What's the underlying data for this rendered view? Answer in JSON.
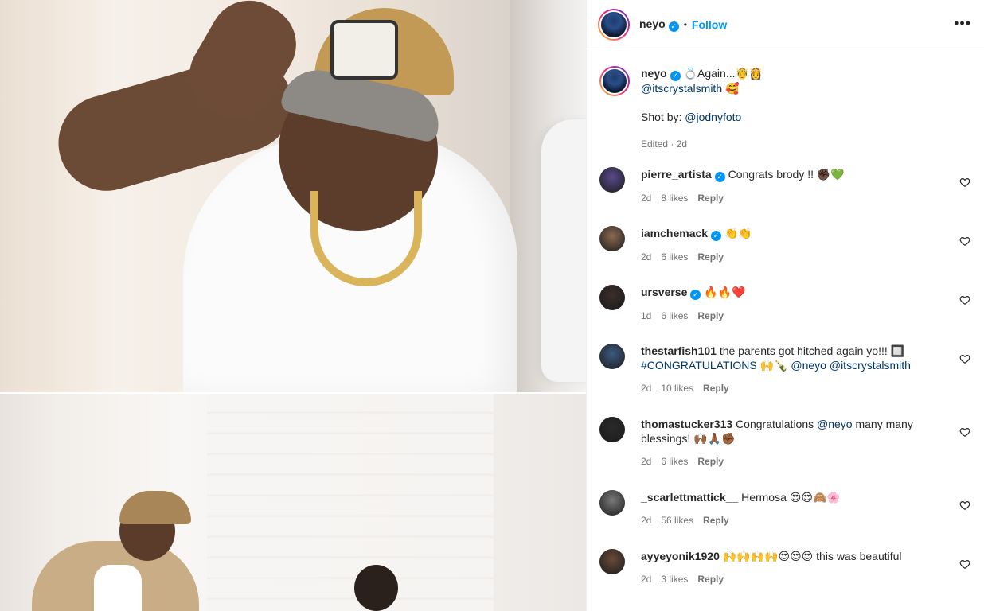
{
  "header": {
    "username": "neyo",
    "verified_badge": "✓",
    "separator": "•",
    "follow_label": "Follow",
    "more_icon": "•••"
  },
  "caption": {
    "username": "neyo",
    "text": "💍Again...🤴👸",
    "mention": "@itscrystalsmith",
    "mention_suffix": " 🥰",
    "shot_by_label": "Shot by: ",
    "shot_by_mention": "@jodnyfoto",
    "meta": "Edited · 2d"
  },
  "comments": [
    {
      "username": "pierre_artista",
      "verified": true,
      "parts": [
        {
          "t": "text",
          "v": "Congrats brody !! ✊🏿💚"
        }
      ],
      "time": "2d",
      "likes": "8 likes",
      "reply": "Reply",
      "avatar_color": "#5a4a8a"
    },
    {
      "username": "iamchemack",
      "verified": true,
      "parts": [
        {
          "t": "text",
          "v": "👏👏"
        }
      ],
      "time": "2d",
      "likes": "6 likes",
      "reply": "Reply",
      "avatar_color": "#8a6a52"
    },
    {
      "username": "ursverse",
      "verified": true,
      "parts": [
        {
          "t": "text",
          "v": "🔥🔥❤️"
        }
      ],
      "time": "1d",
      "likes": "6 likes",
      "reply": "Reply",
      "avatar_color": "#3a2e2a"
    },
    {
      "username": "thestarfish101",
      "verified": false,
      "parts": [
        {
          "t": "text",
          "v": "the parents got hitched again yo!!! 🔲"
        },
        {
          "t": "br"
        },
        {
          "t": "mention",
          "v": "#CONGRATULATIONS"
        },
        {
          "t": "text",
          "v": " 🙌🍾 "
        },
        {
          "t": "mention",
          "v": "@neyo"
        },
        {
          "t": "text",
          "v": " "
        },
        {
          "t": "mention",
          "v": "@itscrystalsmith"
        }
      ],
      "time": "2d",
      "likes": "10 likes",
      "reply": "Reply",
      "avatar_color": "#3c5a80"
    },
    {
      "username": "thomastucker313",
      "verified": false,
      "parts": [
        {
          "t": "text",
          "v": "Congratulations "
        },
        {
          "t": "mention",
          "v": "@neyo"
        },
        {
          "t": "text",
          "v": " many many"
        },
        {
          "t": "br"
        },
        {
          "t": "text",
          "v": "blessings! 🙌🏾🙏🏾✊🏾"
        }
      ],
      "time": "2d",
      "likes": "6 likes",
      "reply": "Reply",
      "avatar_color": "#2a2a2a"
    },
    {
      "username": "_scarlettmattick__",
      "verified": false,
      "parts": [
        {
          "t": "text",
          "v": "Hermosa 😍😍🙈🌸"
        }
      ],
      "time": "2d",
      "likes": "56 likes",
      "reply": "Reply",
      "avatar_color": "#7a7a7a"
    },
    {
      "username": "ayyeyonik1920",
      "verified": false,
      "parts": [
        {
          "t": "text",
          "v": "🙌🙌🙌🙌😍😍😍 this was beautiful"
        }
      ],
      "time": "2d",
      "likes": "3 likes",
      "reply": "Reply",
      "avatar_color": "#6a4a3a"
    }
  ],
  "icons": {
    "heart": "heart-outline",
    "verified": "blue-check",
    "more": "three-dots"
  },
  "colors": {
    "accent": "#0095f6",
    "mention": "#00376b",
    "meta": "#737373",
    "text": "#262626"
  }
}
